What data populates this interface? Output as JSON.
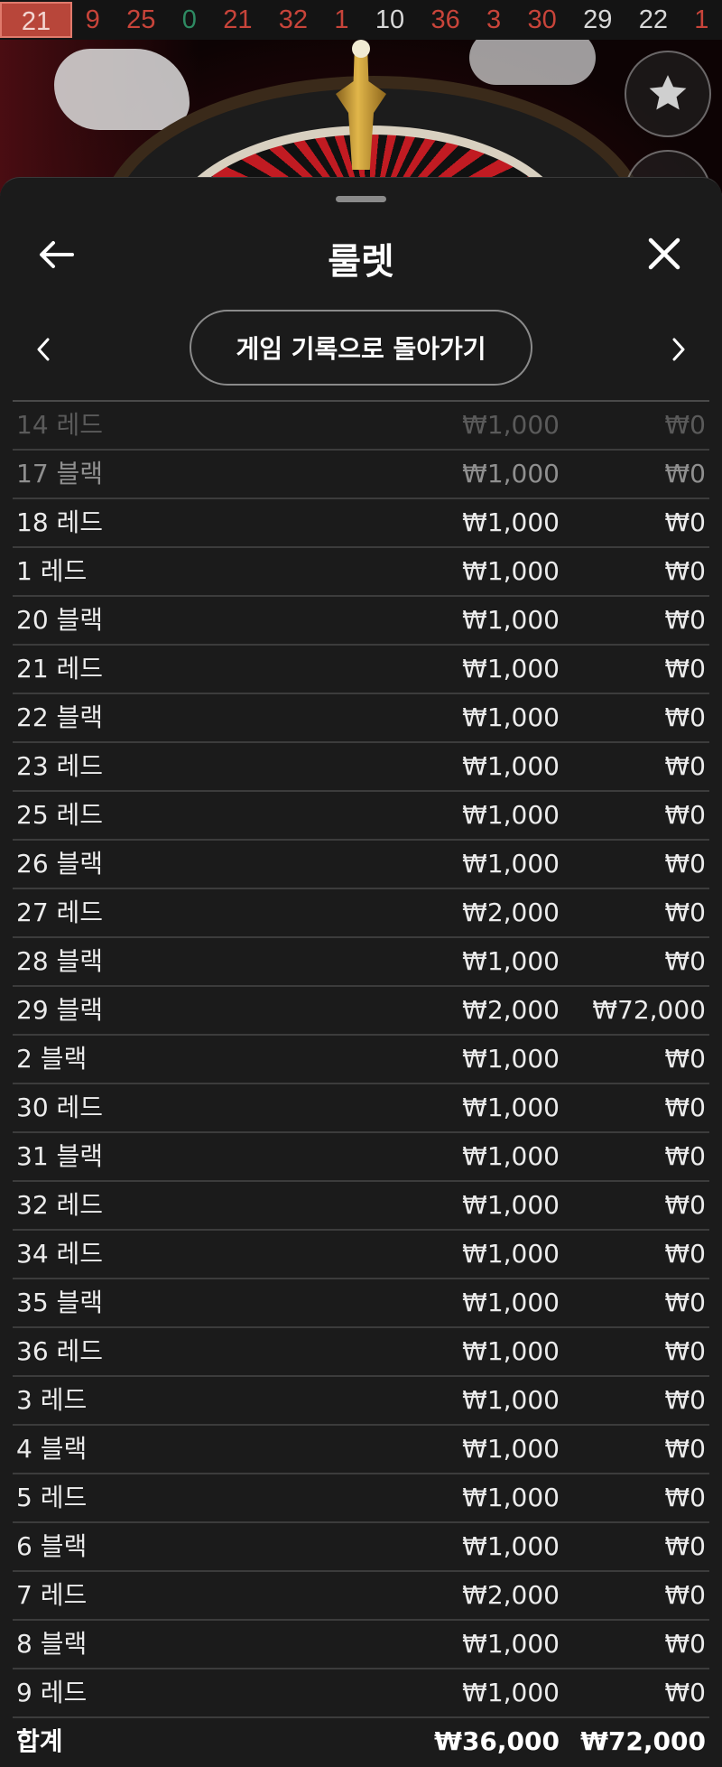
{
  "results_strip": [
    {
      "value": "21",
      "color": "current"
    },
    {
      "value": "9",
      "color": "red"
    },
    {
      "value": "25",
      "color": "red"
    },
    {
      "value": "0",
      "color": "green"
    },
    {
      "value": "21",
      "color": "red"
    },
    {
      "value": "32",
      "color": "red"
    },
    {
      "value": "1",
      "color": "red"
    },
    {
      "value": "10",
      "color": "black"
    },
    {
      "value": "36",
      "color": "red"
    },
    {
      "value": "3",
      "color": "red"
    },
    {
      "value": "30",
      "color": "red"
    },
    {
      "value": "29",
      "color": "black"
    },
    {
      "value": "22",
      "color": "black"
    },
    {
      "value": "1",
      "color": "red"
    }
  ],
  "icons": {
    "favorite": "star-icon",
    "back": "arrow-left-icon",
    "close": "close-icon",
    "prev": "chevron-left-icon",
    "next": "chevron-right-icon"
  },
  "header": {
    "title": "룰렛"
  },
  "nav": {
    "history_button": "게임 기록으로 돌아가기"
  },
  "bets": [
    {
      "bet": "14 레드",
      "stake": "₩1,000",
      "payout": "₩0"
    },
    {
      "bet": "17 블랙",
      "stake": "₩1,000",
      "payout": "₩0"
    },
    {
      "bet": "18 레드",
      "stake": "₩1,000",
      "payout": "₩0"
    },
    {
      "bet": "1 레드",
      "stake": "₩1,000",
      "payout": "₩0"
    },
    {
      "bet": "20 블랙",
      "stake": "₩1,000",
      "payout": "₩0"
    },
    {
      "bet": "21 레드",
      "stake": "₩1,000",
      "payout": "₩0"
    },
    {
      "bet": "22 블랙",
      "stake": "₩1,000",
      "payout": "₩0"
    },
    {
      "bet": "23 레드",
      "stake": "₩1,000",
      "payout": "₩0"
    },
    {
      "bet": "25 레드",
      "stake": "₩1,000",
      "payout": "₩0"
    },
    {
      "bet": "26 블랙",
      "stake": "₩1,000",
      "payout": "₩0"
    },
    {
      "bet": "27 레드",
      "stake": "₩2,000",
      "payout": "₩0"
    },
    {
      "bet": "28 블랙",
      "stake": "₩1,000",
      "payout": "₩0"
    },
    {
      "bet": "29 블랙",
      "stake": "₩2,000",
      "payout": "₩72,000"
    },
    {
      "bet": "2 블랙",
      "stake": "₩1,000",
      "payout": "₩0"
    },
    {
      "bet": "30 레드",
      "stake": "₩1,000",
      "payout": "₩0"
    },
    {
      "bet": "31 블랙",
      "stake": "₩1,000",
      "payout": "₩0"
    },
    {
      "bet": "32 레드",
      "stake": "₩1,000",
      "payout": "₩0"
    },
    {
      "bet": "34 레드",
      "stake": "₩1,000",
      "payout": "₩0"
    },
    {
      "bet": "35 블랙",
      "stake": "₩1,000",
      "payout": "₩0"
    },
    {
      "bet": "36 레드",
      "stake": "₩1,000",
      "payout": "₩0"
    },
    {
      "bet": "3 레드",
      "stake": "₩1,000",
      "payout": "₩0"
    },
    {
      "bet": "4 블랙",
      "stake": "₩1,000",
      "payout": "₩0"
    },
    {
      "bet": "5 레드",
      "stake": "₩1,000",
      "payout": "₩0"
    },
    {
      "bet": "6 블랙",
      "stake": "₩1,000",
      "payout": "₩0"
    },
    {
      "bet": "7 레드",
      "stake": "₩2,000",
      "payout": "₩0"
    },
    {
      "bet": "8 블랙",
      "stake": "₩1,000",
      "payout": "₩0"
    },
    {
      "bet": "9 레드",
      "stake": "₩1,000",
      "payout": "₩0"
    }
  ],
  "total": {
    "label": "합계",
    "stake": "₩36,000",
    "payout": "₩72,000"
  }
}
